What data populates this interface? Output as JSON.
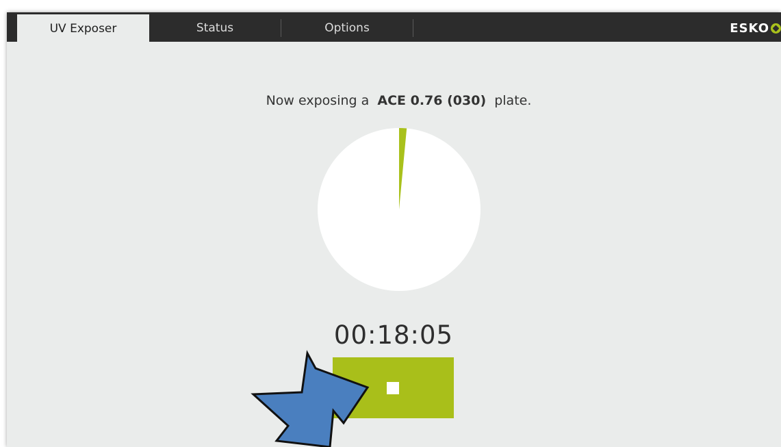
{
  "tabs": [
    {
      "label": "UV Exposer",
      "active": true
    },
    {
      "label": "Status",
      "active": false
    },
    {
      "label": "Options",
      "active": false
    }
  ],
  "brand": {
    "logo_text": "ESKO",
    "accent_color": "#a9c11c"
  },
  "exposure": {
    "message_prefix": "Now exposing a",
    "plate_name": "ACE 0.76 (030)",
    "message_suffix": "plate.",
    "progress_fraction": 0.015,
    "timer": "00:18:05"
  },
  "controls": {
    "stop_button_icon": "stop-icon",
    "stop_button_color": "#a9bf1a"
  },
  "annotation": {
    "pointer_icon": "arrow-icon",
    "pointer_color": "#4a7fbf"
  }
}
